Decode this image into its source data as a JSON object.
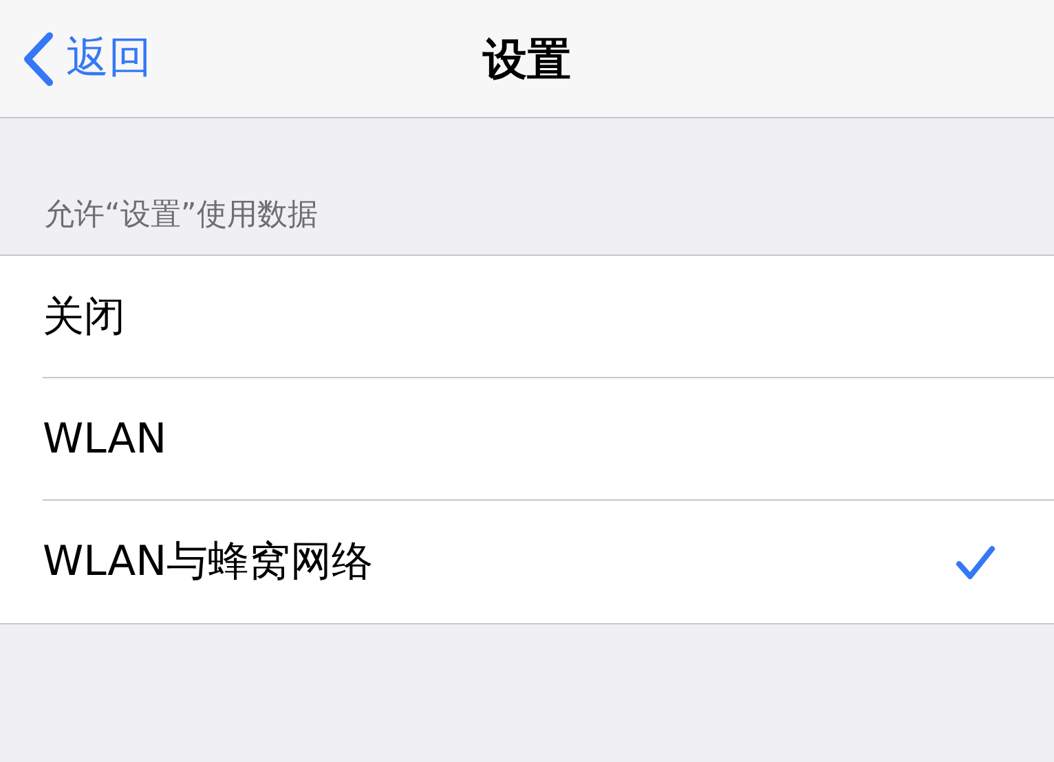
{
  "nav_bar": {
    "back_label": "返回",
    "title": "设置"
  },
  "section": {
    "header": "允许“设置”使用数据",
    "options": [
      {
        "label": "关闭",
        "selected": false
      },
      {
        "label": "WLAN",
        "selected": false
      },
      {
        "label": "WLAN与蜂窝网络",
        "selected": true
      }
    ]
  }
}
